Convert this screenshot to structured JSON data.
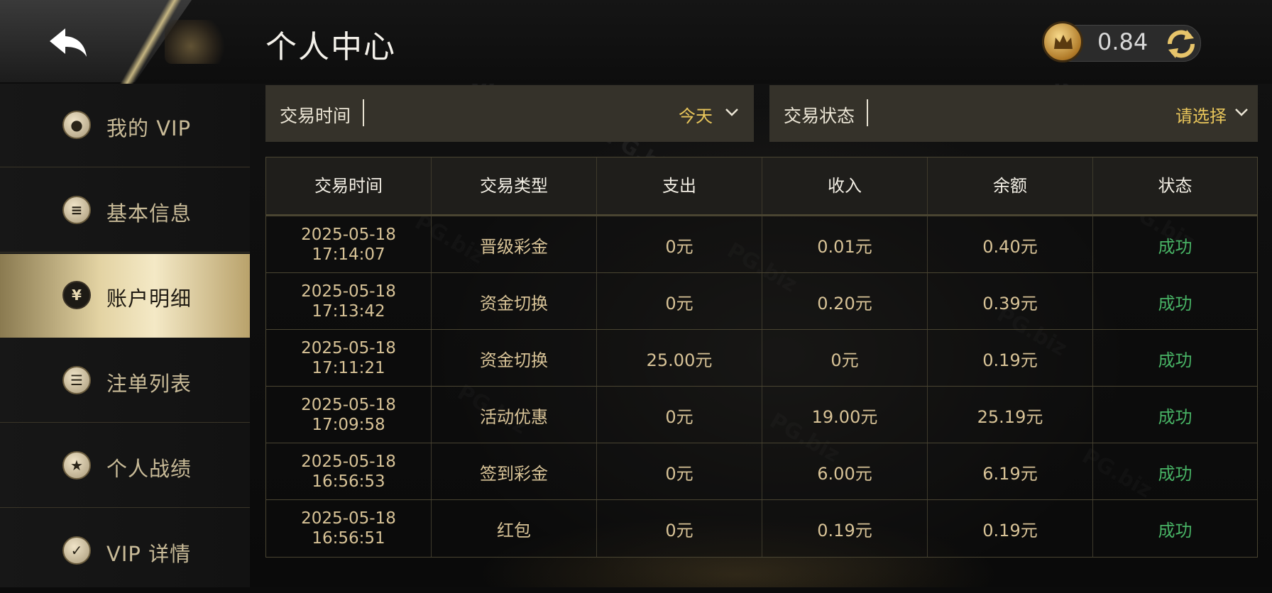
{
  "header": {
    "title": "个人中心",
    "balance": "0.84"
  },
  "sidebar": {
    "items": [
      {
        "label": "我的 VIP",
        "icon": "user-icon",
        "active": false
      },
      {
        "label": "基本信息",
        "icon": "document-icon",
        "active": false
      },
      {
        "label": "账户明细",
        "icon": "yen-icon",
        "active": true
      },
      {
        "label": "注单列表",
        "icon": "list-icon",
        "active": false
      },
      {
        "label": "个人战绩",
        "icon": "medal-icon",
        "active": false
      },
      {
        "label": "VIP 详情",
        "icon": "vip-check-icon",
        "active": false
      }
    ]
  },
  "filters": {
    "time_label": "交易时间",
    "time_value": "今天",
    "status_label": "交易状态",
    "status_value": "请选择"
  },
  "table": {
    "columns": [
      "交易时间",
      "交易类型",
      "支出",
      "收入",
      "余额",
      "状态"
    ],
    "rows": [
      {
        "date": "2025-05-18",
        "time": "17:14:07",
        "type": "晋级彩金",
        "expense": "0元",
        "income": "0.01元",
        "balance": "0.40元",
        "status": "成功"
      },
      {
        "date": "2025-05-18",
        "time": "17:13:42",
        "type": "资金切换",
        "expense": "0元",
        "income": "0.20元",
        "balance": "0.39元",
        "status": "成功"
      },
      {
        "date": "2025-05-18",
        "time": "17:11:21",
        "type": "资金切换",
        "expense": "25.00元",
        "income": "0元",
        "balance": "0.19元",
        "status": "成功"
      },
      {
        "date": "2025-05-18",
        "time": "17:09:58",
        "type": "活动优惠",
        "expense": "0元",
        "income": "19.00元",
        "balance": "25.19元",
        "status": "成功"
      },
      {
        "date": "2025-05-18",
        "time": "16:56:53",
        "type": "签到彩金",
        "expense": "0元",
        "income": "6.00元",
        "balance": "6.19元",
        "status": "成功"
      },
      {
        "date": "2025-05-18",
        "time": "16:56:51",
        "type": "红包",
        "expense": "0元",
        "income": "0.19元",
        "balance": "0.19元",
        "status": "成功"
      }
    ]
  },
  "colors": {
    "accent_gold": "#e9c65b",
    "text_gold": "#d8c397",
    "status_success": "#48b365"
  },
  "watermark": "PG.biz"
}
